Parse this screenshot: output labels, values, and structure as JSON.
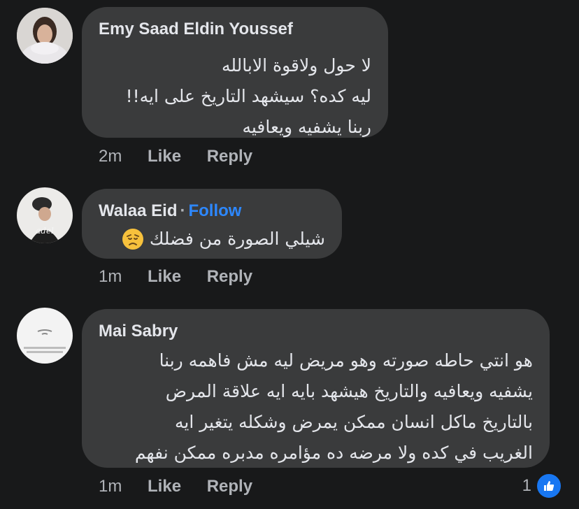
{
  "comments": [
    {
      "author": "Emy Saad Eldin Youssef",
      "lines": [
        "لا حول ولاقوة الابالله",
        "ليه كده؟ سيشهد التاريخ على ايه!!",
        "ربنا يشفيه ويعافيه"
      ],
      "time": "2m",
      "like": "Like",
      "reply": "Reply"
    },
    {
      "author": "Walaa Eid",
      "separator": "·",
      "follow": "Follow",
      "lines": [
        "شيلي الصورة من فضلك"
      ],
      "emoji": "disappointed-face-icon",
      "time": "1m",
      "like": "Like",
      "reply": "Reply"
    },
    {
      "author": "Mai Sabry",
      "lines": [
        "هو انتي حاطه صورته وهو مريض ليه مش فاهمه ربنا",
        "يشفيه ويعافيه والتاريخ هيشهد بايه ايه علاقة المرض",
        "بالتاريخ ماكل انسان ممكن يمرض وشكله يتغير ايه",
        "الغريب في كده ولا مرضه ده مؤامره مدبره ممكن نفهم"
      ],
      "time": "1m",
      "like": "Like",
      "reply": "Reply",
      "reaction_count": "1",
      "reaction_icon": "like-reaction-icon"
    }
  ],
  "colors": {
    "background": "#18191a",
    "bubble": "#3a3b3c",
    "text": "#e4e6eb",
    "muted": "#b0b3b8",
    "follow": "#2d88ff",
    "like_icon": "#1877f2"
  }
}
